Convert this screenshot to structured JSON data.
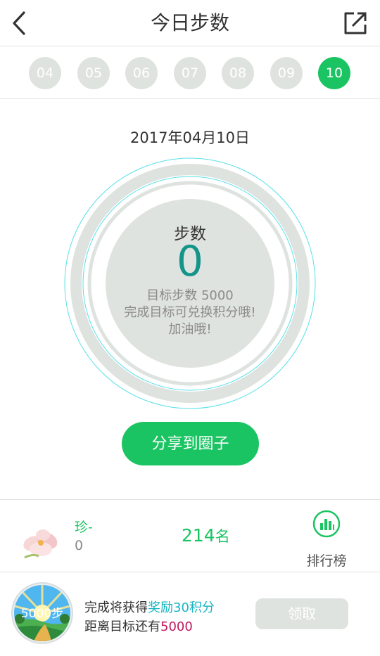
{
  "header": {
    "title": "今日步数",
    "back_icon": "chevron-left-icon",
    "share_icon": "external-share-icon"
  },
  "days": [
    {
      "label": "04",
      "active": false
    },
    {
      "label": "05",
      "active": false
    },
    {
      "label": "06",
      "active": false
    },
    {
      "label": "07",
      "active": false
    },
    {
      "label": "08",
      "active": false
    },
    {
      "label": "09",
      "active": false
    },
    {
      "label": "10",
      "active": true
    }
  ],
  "main": {
    "date": "2017年04月10日",
    "steps_label": "步数",
    "steps_value": "0",
    "goal_text": "目标步数 5000",
    "hint_line1": "完成目标可兑换积分哦!",
    "hint_line2": "加油哦!",
    "progress_fraction": 0,
    "share_button": "分享到圈子"
  },
  "ranking": {
    "user_name": "珍-",
    "user_steps": "0",
    "rank_number": "214",
    "rank_suffix": "名",
    "board_label": "排行榜",
    "board_icon": "bar-chart-icon",
    "avatar_icon": "flower-avatar-icon"
  },
  "reward": {
    "badge_text": "5000步",
    "line1_prefix": "完成将获得",
    "line1_highlight": "奖励30积分",
    "line2_prefix": "距离目标还有",
    "line2_highlight": "5000",
    "claim_button": "领取"
  },
  "colors": {
    "accent_green": "#1bc462",
    "steps_teal": "#15958a",
    "ring_gray": "#dfe3df",
    "ring_cyan": "#57e0e8",
    "highlight_cyan": "#17b5c2",
    "highlight_pink": "#c2185b"
  }
}
